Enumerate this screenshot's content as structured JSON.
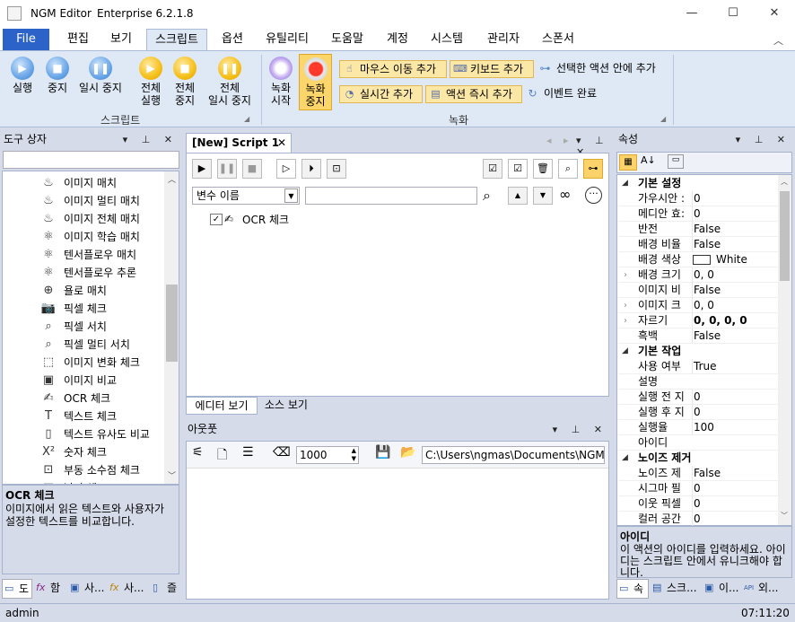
{
  "window": {
    "app": "NGM Editor",
    "edition": "Enterprise 6.2.1.8"
  },
  "tabs": [
    "File",
    "편집",
    "보기",
    "스크립트",
    "옵션",
    "유틸리티",
    "도움말",
    "계정",
    "시스템",
    "관리자",
    "스폰서"
  ],
  "ribbon": {
    "script_group": "스크립트",
    "record_group": "녹화",
    "buttons": {
      "run": "실행",
      "stop": "중지",
      "pause": "일시 중지",
      "run_all_1": "전체",
      "run_all_2": "실행",
      "stop_all_1": "전체",
      "stop_all_2": "중지",
      "pause_all_1": "전체",
      "pause_all_2": "일시 중지",
      "rec_start_1": "녹화",
      "rec_start_2": "시작",
      "rec_stop_1": "녹화",
      "rec_stop_2": "중지"
    },
    "chips": {
      "mouse": "마우스 이동 추가",
      "keyboard": "키보드 추가",
      "realtime": "실시간 추가",
      "immediate": "액션 즉시 추가",
      "in_selected": "선택한 액션 안에 추가",
      "event_done": "이벤트 완료"
    }
  },
  "toolbox": {
    "title": "도구 상자",
    "items": [
      {
        "label": "이미지 매치",
        "icon": "flame-icon"
      },
      {
        "label": "이미지 멀티 매치",
        "icon": "flame-icon"
      },
      {
        "label": "이미지 전체 매치",
        "icon": "flame-icon"
      },
      {
        "label": "이미지 학습 매치",
        "icon": "atom-icon"
      },
      {
        "label": "텐서플로우 매치",
        "icon": "atom-icon"
      },
      {
        "label": "텐서플로우 추론",
        "icon": "atom-icon"
      },
      {
        "label": "욜로 매치",
        "icon": "compass-icon"
      },
      {
        "label": "픽셀 체크",
        "icon": "camera-icon"
      },
      {
        "label": "픽셀 서치",
        "icon": "search-icon"
      },
      {
        "label": "픽셀 멀티 서치",
        "icon": "search-icon"
      },
      {
        "label": "이미지 변화 체크",
        "icon": "image-change-icon"
      },
      {
        "label": "이미지 비교",
        "icon": "image-compare-icon"
      },
      {
        "label": "OCR 체크",
        "icon": "ocr-icon"
      },
      {
        "label": "텍스트 체크",
        "icon": "text-icon"
      },
      {
        "label": "텍스트 유사도 비교",
        "icon": "text-compare-icon"
      },
      {
        "label": "숫자 체크",
        "icon": "number-icon"
      },
      {
        "label": "부동 소수점 체크",
        "icon": "float-icon"
      },
      {
        "label": "날짜 체크",
        "icon": "date-icon"
      }
    ],
    "desc_title": "OCR 체크",
    "desc_text": "이미지에서 읽은 텍스트와 사용자가 설정한 텍스트를 비교합니다.",
    "bottom_tabs": [
      "도",
      "함",
      "사...",
      "사...",
      "즐"
    ]
  },
  "editor": {
    "tab": "[New] Script 1",
    "var_placeholder": "변수 이름",
    "node": "OCR 체크",
    "view_tabs": [
      "에디터 보기",
      "소스 보기"
    ]
  },
  "output": {
    "title": "아웃풋",
    "count": "1000",
    "path": "C:\\Users\\ngmas\\Documents\\NGM6\\"
  },
  "props": {
    "title": "속성",
    "cat1": "기본 설정",
    "rows1": [
      [
        "가우시안 :",
        "0"
      ],
      [
        "메디안 효:",
        "0"
      ],
      [
        "반전",
        "False"
      ],
      [
        "배경 비율",
        "False"
      ],
      [
        "배경 색상",
        "White"
      ],
      [
        "배경 크기",
        "0, 0"
      ],
      [
        "이미지 비",
        "False"
      ],
      [
        "이미지 크",
        "0, 0"
      ],
      [
        "자르기",
        "0, 0, 0, 0"
      ],
      [
        "흑백",
        "False"
      ]
    ],
    "cat2": "기본 작업",
    "rows2": [
      [
        "사용 여부",
        "True"
      ],
      [
        "설명",
        ""
      ],
      [
        "실행 전 지",
        "0"
      ],
      [
        "실행 후 지",
        "0"
      ],
      [
        "실행율",
        "100"
      ],
      [
        "아이디",
        ""
      ]
    ],
    "cat3": "노이즈 제거",
    "rows3": [
      [
        "노이즈 제",
        "False"
      ],
      [
        "시그마 필",
        "0"
      ],
      [
        "이웃 픽셀",
        "0"
      ],
      [
        "컬러 공간",
        "0"
      ]
    ],
    "desc_title": "아이디",
    "desc_text": "이 액션의 아이디를 입력하세요. 아이디는 스크립트 안에서 유니크해야 합니다.",
    "bottom_tabs": [
      "속",
      "스크...",
      "이...",
      "외..."
    ]
  },
  "status": {
    "user": "admin",
    "time": "07:11:20"
  }
}
